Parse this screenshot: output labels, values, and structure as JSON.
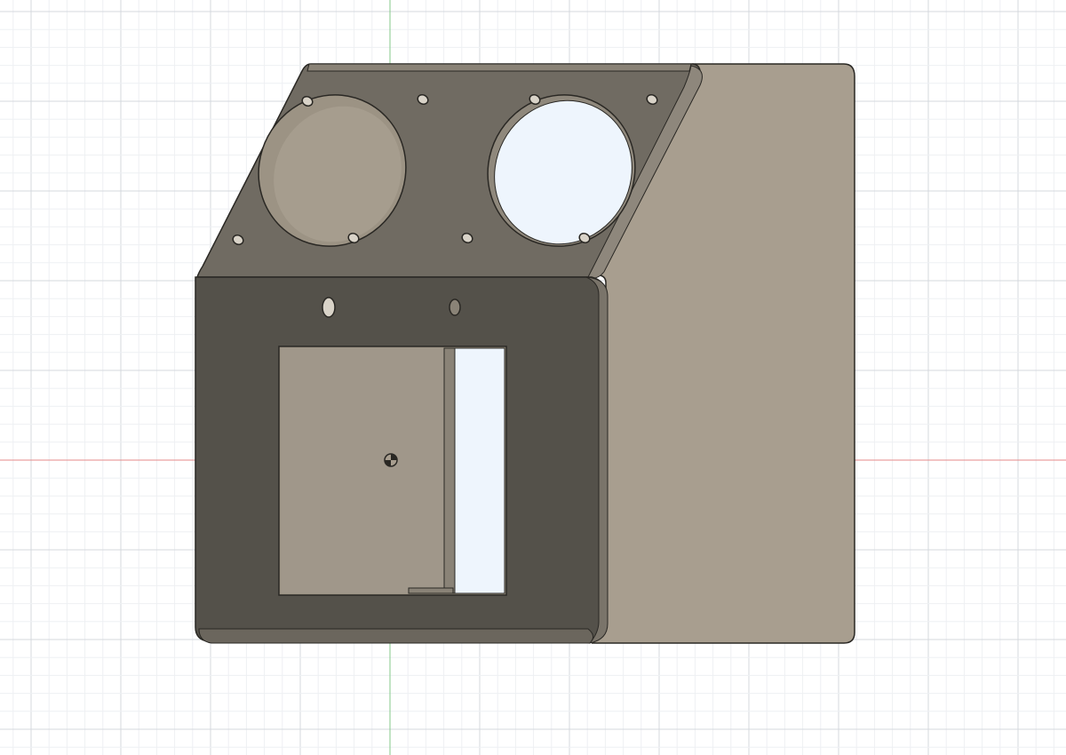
{
  "viewport": {
    "name": "3d-model-viewport",
    "background_color": "#ffffff",
    "grid_minor_color": "#eef0f3",
    "grid_major_color": "#d4d8de",
    "x_axis_color": "#e48a8a",
    "y_axis_color": "#84c98a"
  },
  "model": {
    "name": "enclosure-body",
    "colors": {
      "front_face": "#54514a",
      "side_face": "#a89e8f",
      "top_face": "#706b62",
      "inner_wall": "#9c9384",
      "edge": "#2a2824",
      "highlight": "#d9d3c8",
      "see_through": "#eef5fd"
    }
  }
}
